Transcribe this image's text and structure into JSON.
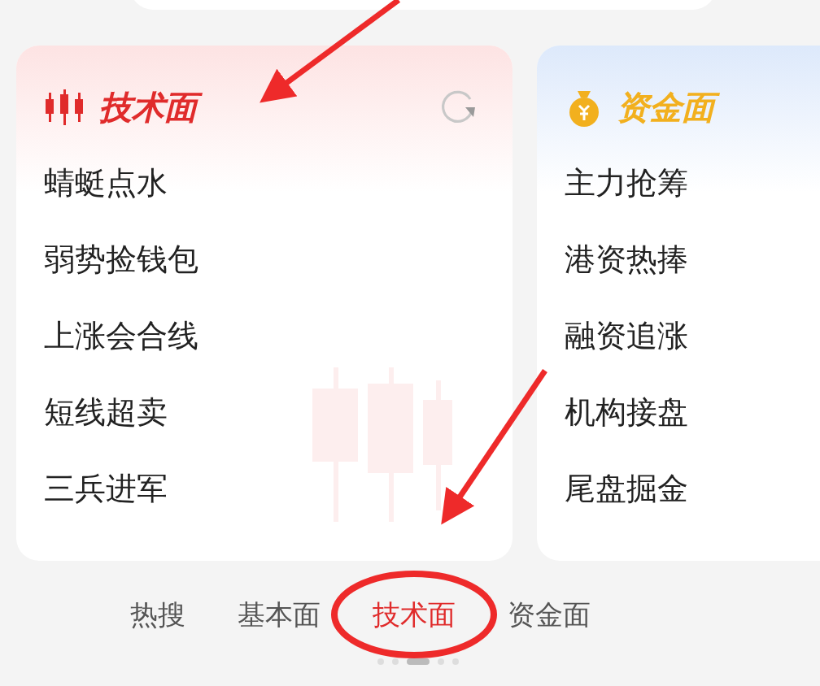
{
  "cards": [
    {
      "title": "技术面",
      "kind": "technical",
      "items": [
        "蜻蜓点水",
        "弱势捡钱包",
        "上涨会合线",
        "短线超卖",
        "三兵进军"
      ]
    },
    {
      "title": "资金面",
      "kind": "capital",
      "items": [
        "主力抢筹",
        "港资热捧",
        "融资追涨",
        "机构接盘",
        "尾盘掘金"
      ]
    }
  ],
  "tabs": [
    {
      "label": "热搜",
      "selected": false
    },
    {
      "label": "基本面",
      "selected": false
    },
    {
      "label": "技术面",
      "selected": true
    },
    {
      "label": "资金面",
      "selected": false
    }
  ],
  "page_dots": [
    {
      "selected": false
    },
    {
      "selected": false
    },
    {
      "selected": true
    },
    {
      "selected": false
    },
    {
      "selected": false
    }
  ]
}
